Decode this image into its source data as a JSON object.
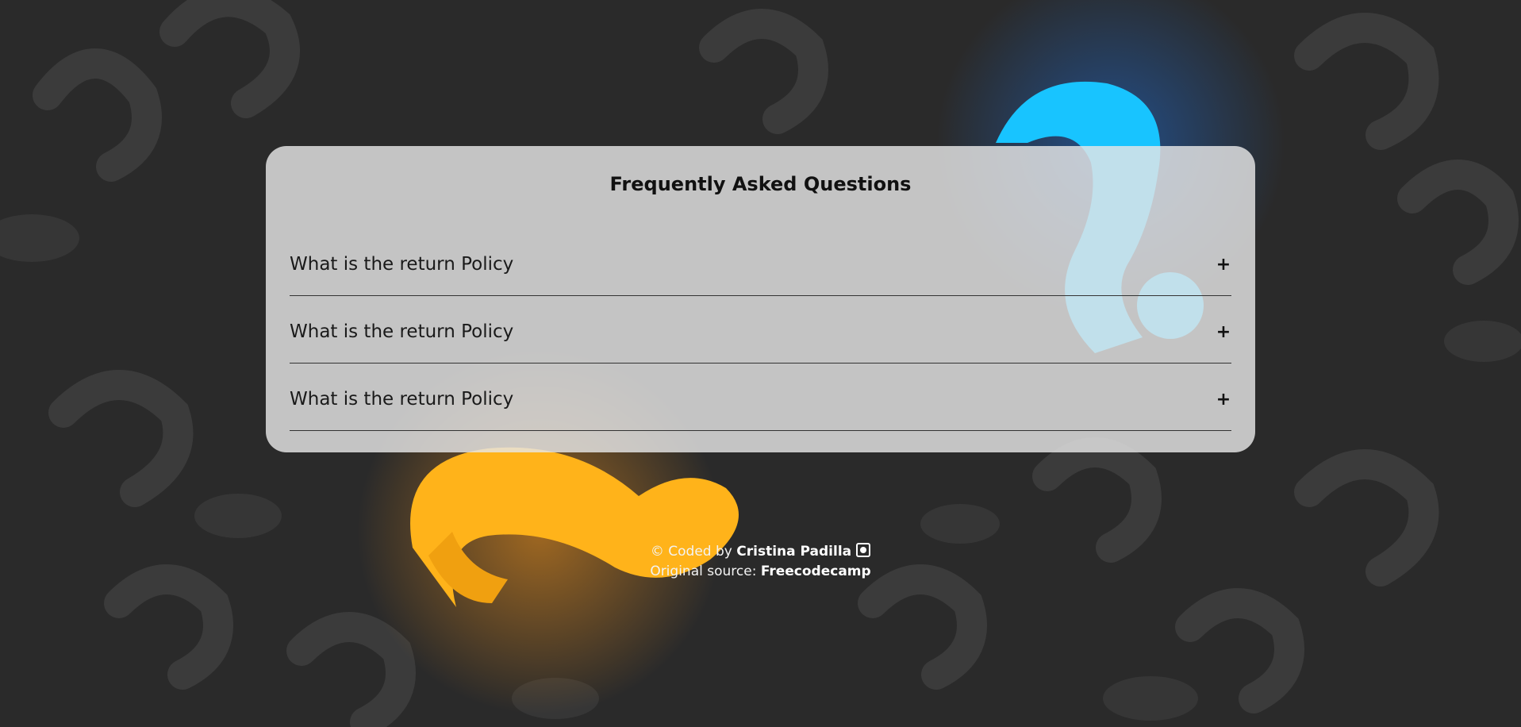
{
  "page": {
    "title": "Frequently Asked Questions",
    "accent_colors": {
      "background": "#2e2e2e",
      "card": "#e6e6e6",
      "highlight_orange": "#ffb31a",
      "highlight_blue": "#18c4ff"
    }
  },
  "faq": {
    "items": [
      {
        "question": "What is the return Policy",
        "toggle": "+"
      },
      {
        "question": "What is the return Policy",
        "toggle": "+"
      },
      {
        "question": "What is the return Policy",
        "toggle": "+"
      }
    ]
  },
  "footer": {
    "coded_by_prefix": "© Coded by",
    "author": "Cristina Padilla",
    "author_icon": "github-icon",
    "source_prefix": "Original source:",
    "source_name": "Freecodecamp"
  }
}
